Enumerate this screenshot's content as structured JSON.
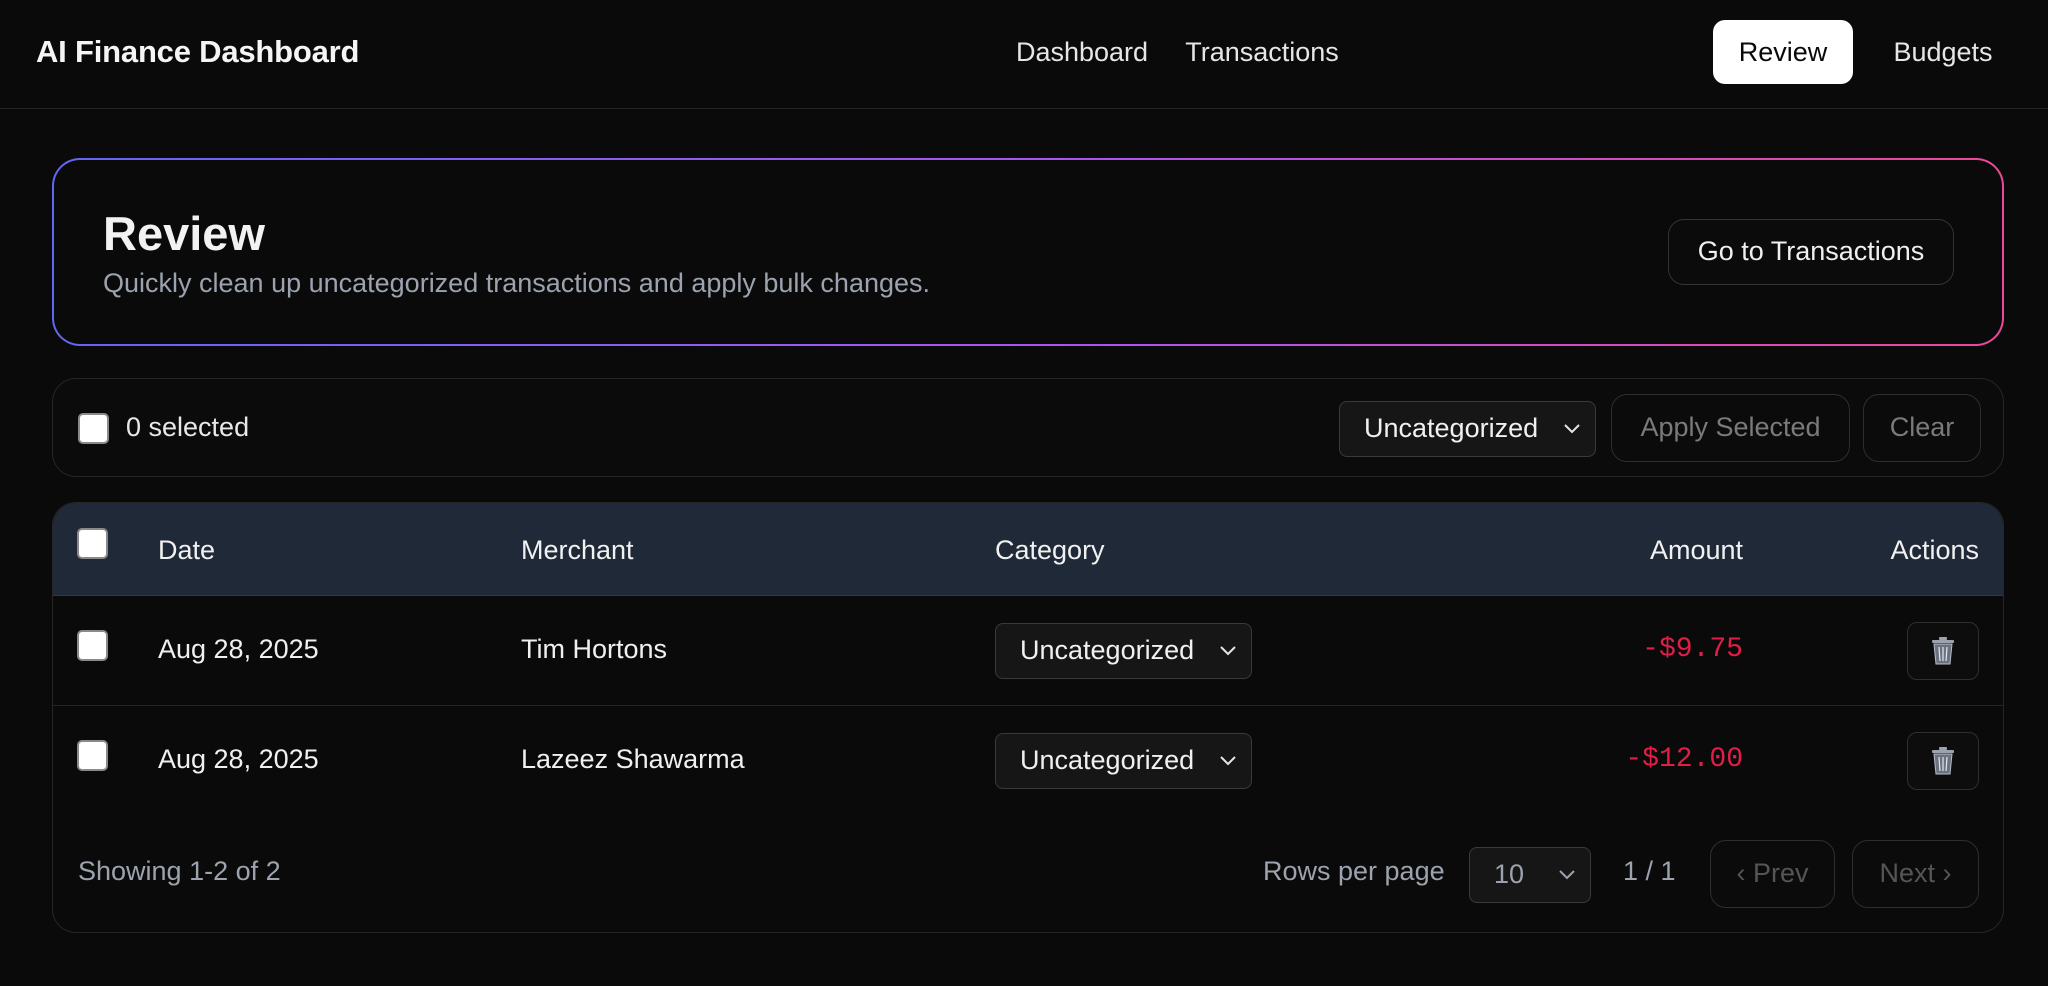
{
  "app": {
    "title": "AI Finance Dashboard"
  },
  "nav": {
    "items": [
      {
        "label": "Dashboard",
        "active": false
      },
      {
        "label": "Transactions",
        "active": false
      },
      {
        "label": "Review",
        "active": true
      },
      {
        "label": "Budgets",
        "active": false
      }
    ]
  },
  "review": {
    "title": "Review",
    "subtitle": "Quickly clean up uncategorized transactions and apply bulk changes.",
    "goto_label": "Go to Transactions"
  },
  "bulk": {
    "selected_label": "0 selected",
    "selected_checked": false,
    "category_value": "Uncategorized",
    "apply_label": "Apply Selected",
    "clear_label": "Clear"
  },
  "table": {
    "headers": {
      "date": "Date",
      "merchant": "Merchant",
      "category": "Category",
      "amount": "Amount",
      "actions": "Actions"
    },
    "rows": [
      {
        "checked": false,
        "date": "Aug 28, 2025",
        "merchant": "Tim Hortons",
        "category": "Uncategorized",
        "amount": "-$9.75",
        "action_icon": "trash-icon"
      },
      {
        "checked": false,
        "date": "Aug 28, 2025",
        "merchant": "Lazeez Shawarma",
        "category": "Uncategorized",
        "amount": "-$12.00",
        "action_icon": "trash-icon"
      }
    ]
  },
  "pagination": {
    "showing": "Showing 1-2 of 2",
    "rows_per_page_label": "Rows per page",
    "rows_per_page_value": "10",
    "page_indicator": "1 / 1",
    "prev_label": "‹ Prev",
    "next_label": "Next ›"
  },
  "colors": {
    "background": "#0a0a0a",
    "header_row": "#1f2937",
    "amount_negative": "#e11d48",
    "gradient_start": "#6366f1",
    "gradient_end": "#ec4899",
    "active_nav_bg": "#ffffff"
  }
}
